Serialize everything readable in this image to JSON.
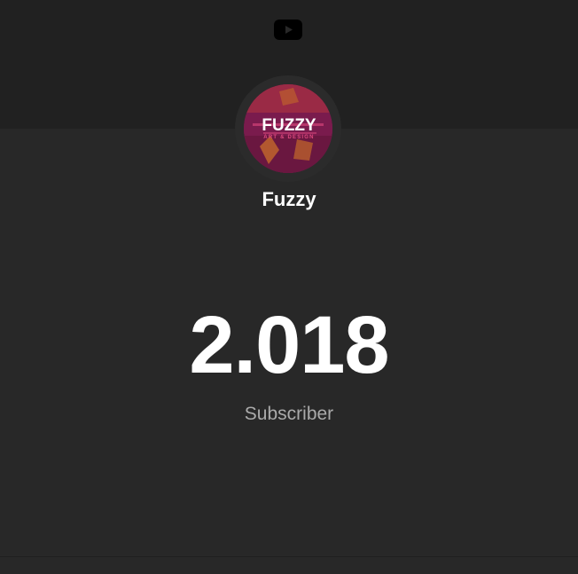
{
  "header": {
    "logo_icon": "youtube-play-icon",
    "logo_color": "#000000"
  },
  "channel": {
    "name": "Fuzzy",
    "avatar": {
      "title": "FUZZY",
      "subtitle": "ART & DESIGN",
      "primary_color": "#7a1b4d",
      "accent_color": "#c4692a"
    }
  },
  "stats": {
    "subscriber_count": "2.018",
    "subscriber_label": "Subscriber"
  },
  "colors": {
    "background": "#282828",
    "top_band": "#212121",
    "text_primary": "#ffffff",
    "text_secondary": "#aaaaaa"
  }
}
